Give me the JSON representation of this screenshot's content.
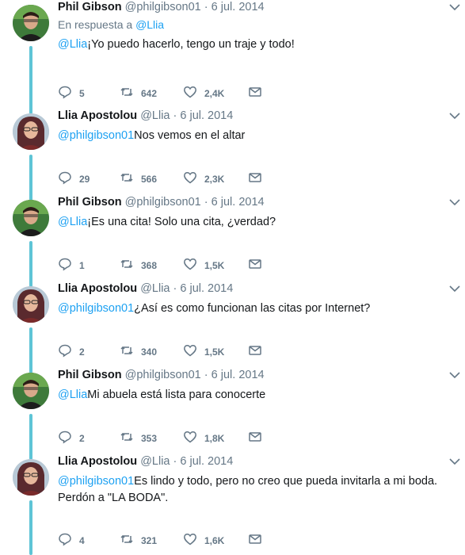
{
  "colors": {
    "accent": "#1da1f2",
    "thread_line": "#5ec4d6",
    "muted": "#657786"
  },
  "tweets": [
    {
      "name": "Phil Gibson",
      "handle": "@philgibson01",
      "date": "6 jul. 2014",
      "avatar": "phil",
      "reply_prefix": "En respuesta a",
      "reply_mention": "@Llia",
      "mention": "@Llia",
      "text": "¡Yo puedo hacerlo, tengo un traje y todo!",
      "text2": "",
      "replies": "5",
      "retweets": "642",
      "likes": "2,4K"
    },
    {
      "name": "Llia Apostolou",
      "handle": "@Llia",
      "date": "6 jul. 2014",
      "avatar": "llia",
      "mention": "@philgibson01",
      "text": "Nos vemos en el altar",
      "text2": "",
      "replies": "29",
      "retweets": "566",
      "likes": "2,3K"
    },
    {
      "name": "Phil Gibson",
      "handle": "@philgibson01",
      "date": "6 jul. 2014",
      "avatar": "phil",
      "mention": "@Llia",
      "text": "¡Es una cita! Solo una cita, ¿verdad?",
      "text2": "",
      "replies": "1",
      "retweets": "368",
      "likes": "1,5K"
    },
    {
      "name": "Llia Apostolou",
      "handle": "@Llia",
      "date": "6 jul. 2014",
      "avatar": "llia",
      "mention": "@philgibson01",
      "text": "¿Así es como funcionan las citas por Internet?",
      "text2": "",
      "replies": "2",
      "retweets": "340",
      "likes": "1,5K"
    },
    {
      "name": "Phil Gibson",
      "handle": "@philgibson01",
      "date": "6 jul. 2014",
      "avatar": "phil",
      "mention": "@Llia",
      "text": "Mi abuela está lista para conocerte",
      "text2": "",
      "replies": "2",
      "retweets": "353",
      "likes": "1,8K"
    },
    {
      "name": "Llia Apostolou",
      "handle": "@Llia",
      "date": "6 jul. 2014",
      "avatar": "llia",
      "mention": "@philgibson01",
      "text": "Es lindo y todo, pero no creo que pueda invitarla a mi boda.",
      "text2": "Perdón a \"LA BODA\".",
      "replies": "4",
      "retweets": "321",
      "likes": "1,6K"
    }
  ]
}
